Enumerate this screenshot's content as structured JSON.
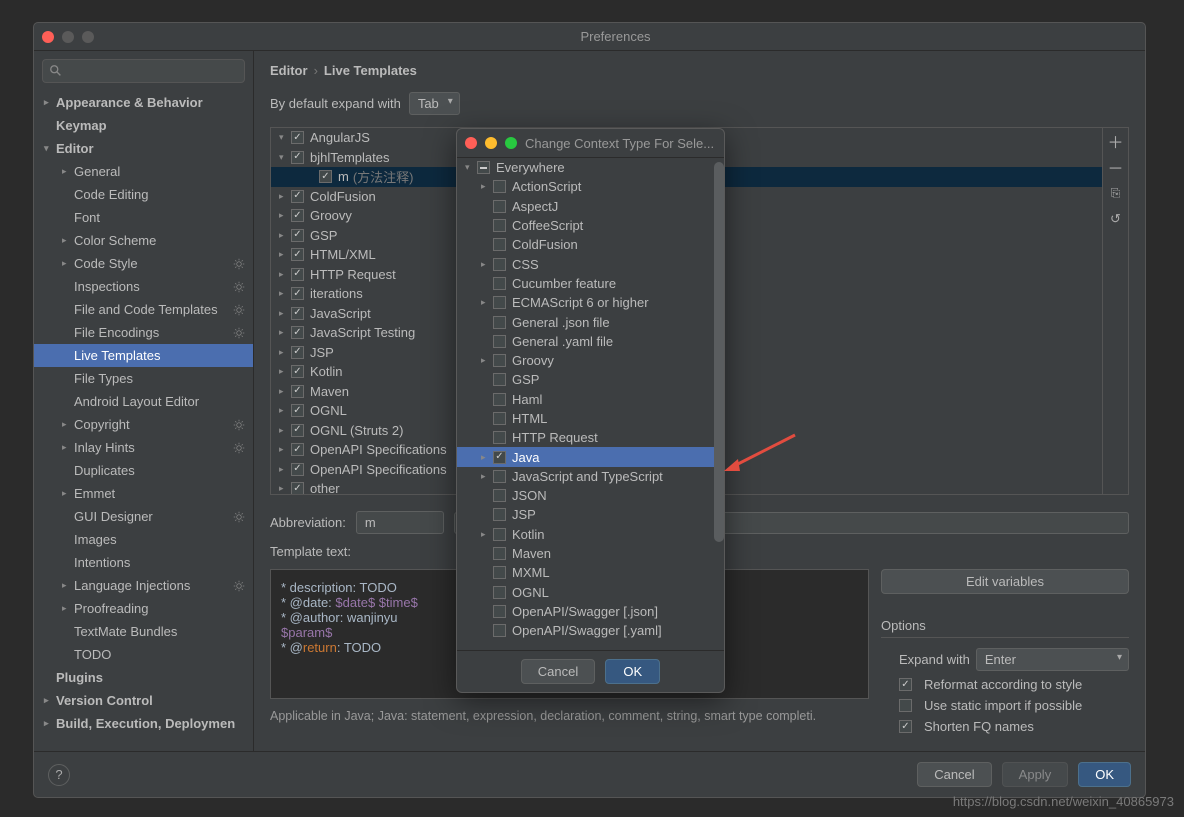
{
  "window_title": "Preferences",
  "breadcrumb": {
    "a": "Editor",
    "b": "Live Templates"
  },
  "expand_label": "By default expand with",
  "expand_value": "Tab",
  "sidebar": [
    {
      "label": "Appearance & Behavior",
      "bold": true,
      "arrow": "▸",
      "ind": 0
    },
    {
      "label": "Keymap",
      "bold": true,
      "ind": 0
    },
    {
      "label": "Editor",
      "bold": true,
      "arrow": "▾",
      "ind": 0
    },
    {
      "label": "General",
      "arrow": "▸",
      "ind": 1
    },
    {
      "label": "Code Editing",
      "ind": 1
    },
    {
      "label": "Font",
      "ind": 1
    },
    {
      "label": "Color Scheme",
      "arrow": "▸",
      "ind": 1
    },
    {
      "label": "Code Style",
      "arrow": "▸",
      "ind": 1,
      "gear": true
    },
    {
      "label": "Inspections",
      "ind": 1,
      "gear": true
    },
    {
      "label": "File and Code Templates",
      "ind": 1,
      "gear": true
    },
    {
      "label": "File Encodings",
      "ind": 1,
      "gear": true
    },
    {
      "label": "Live Templates",
      "ind": 1,
      "sel": true
    },
    {
      "label": "File Types",
      "ind": 1
    },
    {
      "label": "Android Layout Editor",
      "ind": 1
    },
    {
      "label": "Copyright",
      "arrow": "▸",
      "ind": 1,
      "gear": true
    },
    {
      "label": "Inlay Hints",
      "arrow": "▸",
      "ind": 1,
      "gear": true
    },
    {
      "label": "Duplicates",
      "ind": 1
    },
    {
      "label": "Emmet",
      "arrow": "▸",
      "ind": 1
    },
    {
      "label": "GUI Designer",
      "ind": 1,
      "gear": true
    },
    {
      "label": "Images",
      "ind": 1
    },
    {
      "label": "Intentions",
      "ind": 1
    },
    {
      "label": "Language Injections",
      "arrow": "▸",
      "ind": 1,
      "gear": true
    },
    {
      "label": "Proofreading",
      "arrow": "▸",
      "ind": 1
    },
    {
      "label": "TextMate Bundles",
      "ind": 1
    },
    {
      "label": "TODO",
      "ind": 1
    },
    {
      "label": "Plugins",
      "bold": true,
      "ind": 0
    },
    {
      "label": "Version Control",
      "bold": true,
      "arrow": "▸",
      "ind": 0
    },
    {
      "label": "Build, Execution, Deploymen",
      "bold": true,
      "arrow": "▸",
      "ind": 0
    }
  ],
  "templates": [
    {
      "arrow": "▾",
      "label": "AngularJS"
    },
    {
      "arrow": "▾",
      "label": "bjhlTemplates"
    },
    {
      "label": "m",
      "desc": "(方法注释)",
      "ind": 2,
      "sel": true
    },
    {
      "arrow": "▸",
      "label": "ColdFusion"
    },
    {
      "arrow": "▸",
      "label": "Groovy"
    },
    {
      "arrow": "▸",
      "label": "GSP"
    },
    {
      "arrow": "▸",
      "label": "HTML/XML"
    },
    {
      "arrow": "▸",
      "label": "HTTP Request"
    },
    {
      "arrow": "▸",
      "label": "iterations"
    },
    {
      "arrow": "▸",
      "label": "JavaScript"
    },
    {
      "arrow": "▸",
      "label": "JavaScript Testing"
    },
    {
      "arrow": "▸",
      "label": "JSP"
    },
    {
      "arrow": "▸",
      "label": "Kotlin"
    },
    {
      "arrow": "▸",
      "label": "Maven"
    },
    {
      "arrow": "▸",
      "label": "OGNL"
    },
    {
      "arrow": "▸",
      "label": "OGNL (Struts 2)"
    },
    {
      "arrow": "▸",
      "label": "OpenAPI Specifications"
    },
    {
      "arrow": "▸",
      "label": "OpenAPI Specifications"
    },
    {
      "arrow": "▸",
      "label": "other"
    }
  ],
  "abbr_label": "Abbreviation:",
  "abbr_value": "m",
  "tt_label": "Template text:",
  "edit_vars": "Edit variables",
  "options_label": "Options",
  "expand2_label": "Expand with",
  "expand2_value": "Enter",
  "opt1": "Reformat according to style",
  "opt2": "Use static import if possible",
  "opt3": "Shorten FQ names",
  "applicable": "Applicable in Java; Java: statement, expression, declaration, comment, string, smart type completi.",
  "cancel": "Cancel",
  "apply": "Apply",
  "ok": "OK",
  "popup_title": "Change Context Type For Sele...",
  "popup_root": "Everywhere",
  "popup_items": [
    {
      "label": "ActionScript",
      "arrow": "▸"
    },
    {
      "label": "AspectJ"
    },
    {
      "label": "CoffeeScript"
    },
    {
      "label": "ColdFusion"
    },
    {
      "label": "CSS",
      "arrow": "▸"
    },
    {
      "label": "Cucumber feature"
    },
    {
      "label": "ECMAScript 6 or higher",
      "arrow": "▸"
    },
    {
      "label": "General .json file"
    },
    {
      "label": "General .yaml file"
    },
    {
      "label": "Groovy",
      "arrow": "▸"
    },
    {
      "label": "GSP"
    },
    {
      "label": "Haml"
    },
    {
      "label": "HTML"
    },
    {
      "label": "HTTP Request"
    },
    {
      "label": "Java",
      "arrow": "▸",
      "sel": true,
      "on": true
    },
    {
      "label": "JavaScript and TypeScript",
      "arrow": "▸"
    },
    {
      "label": "JSON"
    },
    {
      "label": "JSP"
    },
    {
      "label": "Kotlin",
      "arrow": "▸"
    },
    {
      "label": "Maven"
    },
    {
      "label": "MXML"
    },
    {
      "label": "OGNL"
    },
    {
      "label": "OpenAPI/Swagger [.json]"
    },
    {
      "label": "OpenAPI/Swagger [.yaml]"
    }
  ],
  "p_cancel": "Cancel",
  "p_ok": "OK",
  "watermark": "https://blog.csdn.net/weixin_40865973",
  "code": {
    "l1a": " * description: ",
    "l1b": "TODO",
    "l2a": " * @date: ",
    "l2b": "$date$ $time$",
    "l3a": " * @author: ",
    "l3b": "wanjinyu",
    "l4": "$param$",
    "l5a": " * @",
    "l5b": "return",
    "l5c": ": ",
    "l5d": "TODO"
  }
}
